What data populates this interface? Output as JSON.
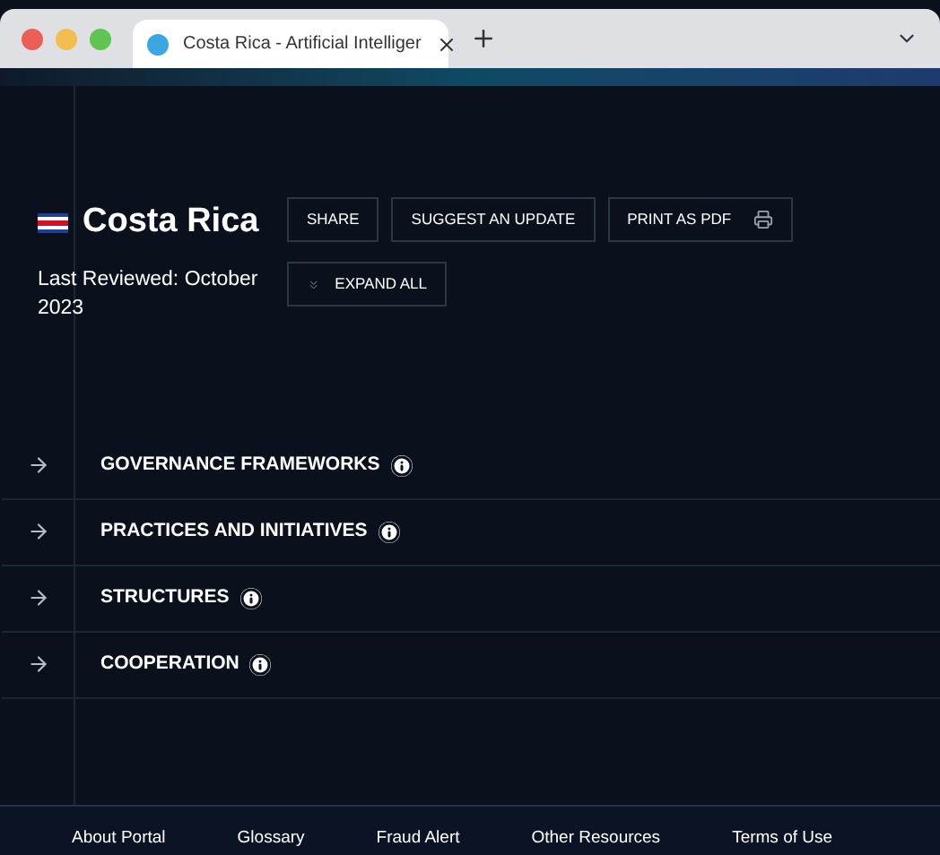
{
  "browser": {
    "tab_title": "Costa Rica - Artificial Intelliger",
    "tab_selected": true
  },
  "page": {
    "country": "Costa Rica",
    "last_reviewed": "Last Reviewed: October 2023",
    "buttons": [
      {
        "label": "SHARE",
        "kind": "plain"
      },
      {
        "label": "SUGGEST AN UPDATE",
        "kind": "plain"
      },
      {
        "label": "PRINT AS PDF",
        "kind": "print"
      }
    ],
    "expand_button": "EXPAND ALL",
    "sections": [
      {
        "title": "GOVERNANCE FRAMEWORKS",
        "expanded": false
      },
      {
        "title": "PRACTICES AND INITIATIVES",
        "expanded": false
      },
      {
        "title": "STRUCTURES",
        "expanded": false
      },
      {
        "title": "COOPERATION",
        "expanded": false
      }
    ]
  },
  "footer": {
    "links": [
      "About Portal",
      "Glossary",
      "Fraud Alert",
      "Other Resources",
      "Terms of Use"
    ]
  }
}
